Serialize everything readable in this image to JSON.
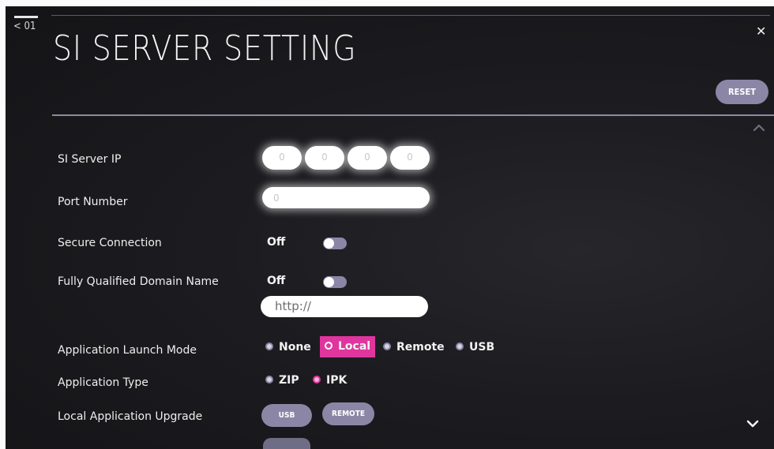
{
  "nav": {
    "back_label": "< 01"
  },
  "header": {
    "title": "SI SERVER SETTING",
    "reset_label": "RESET"
  },
  "icons": {
    "close": "close-icon",
    "scroll_up": "chevron-up-icon",
    "scroll_down": "chevron-down-icon"
  },
  "colors": {
    "accent": "#8b86a6",
    "selected": "#e0359e",
    "background": "#1c1c20"
  },
  "settings": {
    "si_server_ip": {
      "label": "SI Server IP",
      "octets": [
        "0",
        "0",
        "0",
        "0"
      ]
    },
    "port_number": {
      "label": "Port Number",
      "value": "0"
    },
    "secure_connection": {
      "label": "Secure Connection",
      "state": "Off"
    },
    "fqdn": {
      "label": "Fully Qualified Domain Name",
      "state": "Off",
      "url_value": "http://"
    },
    "launch_mode": {
      "label": "Application Launch Mode",
      "options": [
        "None",
        "Local",
        "Remote",
        "USB"
      ],
      "selected": "Local"
    },
    "app_type": {
      "label": "Application Type",
      "options": [
        "ZIP",
        "IPK"
      ],
      "selected": "IPK"
    },
    "local_upgrade": {
      "label": "Local Application Upgrade",
      "buttons": [
        "USB",
        "REMOTE"
      ]
    }
  }
}
